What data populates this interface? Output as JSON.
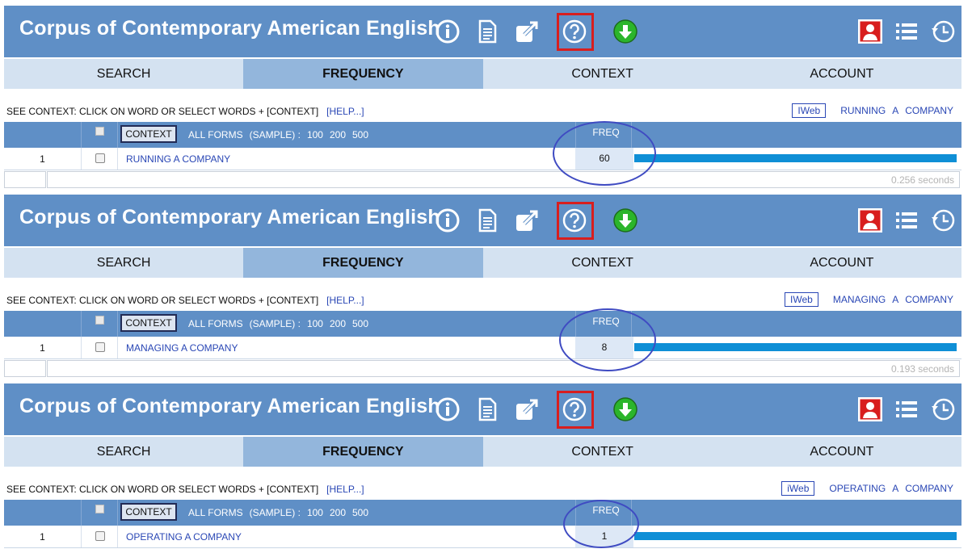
{
  "header": {
    "title": "Corpus of Contemporary American English",
    "icons": [
      "info-icon",
      "document-icon",
      "external-link-icon",
      "help-icon",
      "download-icon",
      "user-icon",
      "list-icon",
      "history-icon"
    ],
    "highlight_color": "#d81e1e",
    "background_color": "#5f8fc6"
  },
  "tabs": [
    {
      "label": "SEARCH",
      "active": false
    },
    {
      "label": "FREQUENCY",
      "active": true
    },
    {
      "label": "CONTEXT",
      "active": false
    },
    {
      "label": "ACCOUNT",
      "active": false
    }
  ],
  "see_context": {
    "text": "SEE CONTEXT: CLICK ON WORD OR SELECT WORDS + [CONTEXT]",
    "help": "[HELP...]"
  },
  "table_header": {
    "context_button": "CONTEXT",
    "all_forms": "ALL FORMS",
    "sample": "(SAMPLE) :",
    "sizes": [
      "100",
      "200",
      "500"
    ],
    "freq": "FREQ"
  },
  "panels": [
    {
      "iweb": "IWeb",
      "query_words": [
        "RUNNING",
        "A",
        "COMPANY"
      ],
      "rows": [
        {
          "num": "1",
          "word": "RUNNING A COMPANY",
          "freq": "60",
          "bar_fraction": 1.0
        }
      ],
      "seconds": "0.256 seconds"
    },
    {
      "iweb": "IWeb",
      "query_words": [
        "MANAGING",
        "A",
        "COMPANY"
      ],
      "rows": [
        {
          "num": "1",
          "word": "MANAGING A COMPANY",
          "freq": "8",
          "bar_fraction": 1.0
        }
      ],
      "seconds": "0.193 seconds"
    },
    {
      "iweb": "iWeb",
      "query_words": [
        "OPERATING",
        "A",
        "COMPANY"
      ],
      "rows": [
        {
          "num": "1",
          "word": "OPERATING A COMPANY",
          "freq": "1",
          "bar_fraction": 1.0
        }
      ],
      "seconds": ""
    }
  ]
}
